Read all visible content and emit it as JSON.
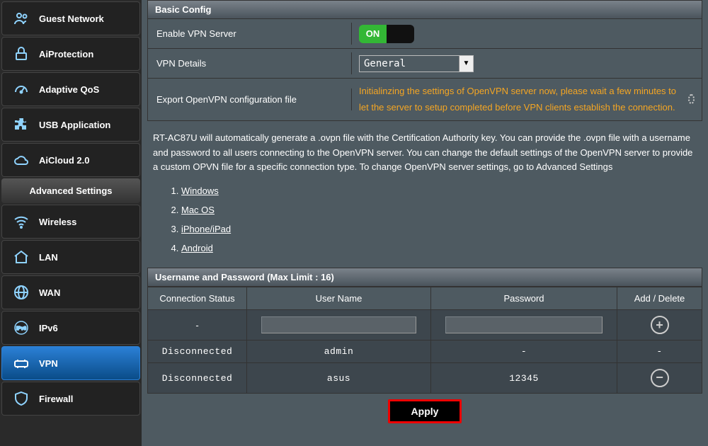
{
  "sidebar": {
    "general": [
      {
        "label": "Guest Network",
        "icon": "users"
      },
      {
        "label": "AiProtection",
        "icon": "lock"
      },
      {
        "label": "Adaptive QoS",
        "icon": "gauge"
      },
      {
        "label": "USB Application",
        "icon": "puzzle"
      },
      {
        "label": "AiCloud 2.0",
        "icon": "cloud"
      }
    ],
    "advanced_header": "Advanced Settings",
    "advanced": [
      {
        "label": "Wireless",
        "icon": "wifi"
      },
      {
        "label": "LAN",
        "icon": "home"
      },
      {
        "label": "WAN",
        "icon": "globe"
      },
      {
        "label": "IPv6",
        "icon": "ipv6"
      },
      {
        "label": "VPN",
        "icon": "vpn",
        "active": true
      },
      {
        "label": "Firewall",
        "icon": "shield"
      }
    ]
  },
  "basic": {
    "header": "Basic Config",
    "enable_label": "Enable VPN Server",
    "toggle_on": "ON",
    "details_label": "VPN Details",
    "details_value": "General",
    "export_label": "Export OpenVPN configuration file",
    "init_message": "Initialinzing the settings of OpenVPN server now, please wait a few minutes to let the server to setup completed before VPN clients establish the connection."
  },
  "description": {
    "text": "RT-AC87U will automatically generate a .ovpn file with the Certification Authority key. You can provide the .ovpn file with a username and password to all users connecting to the OpenVPN server. You can change the default settings of the OpenVPN server to provide a custom OPVN file for a specific connection type. To change OpenVPN server settings, go to Advanced Settings",
    "platforms": [
      "Windows",
      "Mac OS",
      "iPhone/iPad",
      "Android"
    ]
  },
  "credentials": {
    "header": "Username and Password (Max Limit : 16)",
    "columns": {
      "status": "Connection Status",
      "user": "User Name",
      "pass": "Password",
      "action": "Add / Delete"
    },
    "input_row_status": "-",
    "rows": [
      {
        "status": "Disconnected",
        "user": "admin",
        "pass": "-",
        "action": "-"
      },
      {
        "status": "Disconnected",
        "user": "asus",
        "pass": "12345",
        "action": "minus"
      }
    ]
  },
  "apply_label": "Apply"
}
